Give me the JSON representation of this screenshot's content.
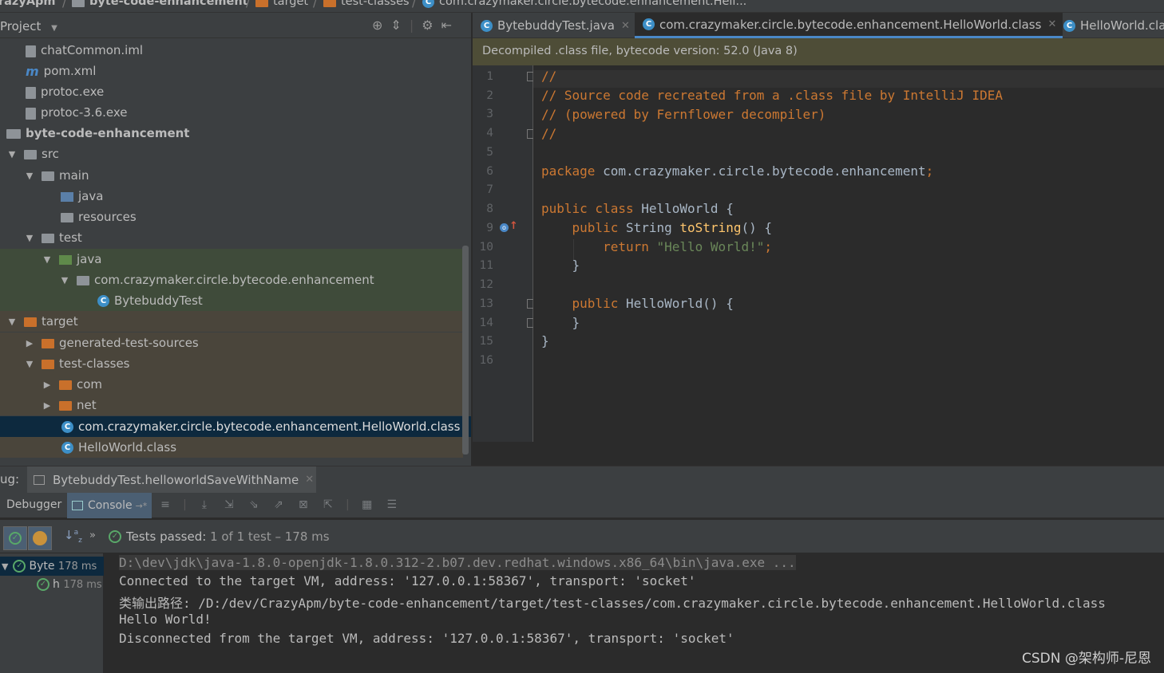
{
  "breadcrumb": {
    "items": [
      "razyApm",
      "byte-code-enhancement",
      "target",
      "test-classes",
      "com.crazymaker.circle.bytecode.enhancement.Hell..."
    ]
  },
  "project": {
    "title": "Project",
    "tree": [
      {
        "label": "chatCommon.iml",
        "icon": "iml-file-icon"
      },
      {
        "label": "pom.xml",
        "icon": "maven-icon"
      },
      {
        "label": "protoc.exe",
        "icon": "exe-file-icon"
      },
      {
        "label": "protoc-3.6.exe",
        "icon": "exe-file-icon"
      },
      {
        "label": "byte-code-enhancement",
        "icon": "module-icon"
      },
      {
        "label": "src",
        "icon": "folder-icon"
      },
      {
        "label": "main",
        "icon": "folder-icon"
      },
      {
        "label": "java",
        "icon": "source-folder-icon"
      },
      {
        "label": "resources",
        "icon": "resources-folder-icon"
      },
      {
        "label": "test",
        "icon": "folder-icon"
      },
      {
        "label": "java",
        "icon": "test-source-folder-icon"
      },
      {
        "label": "com.crazymaker.circle.bytecode.enhancement",
        "icon": "package-icon"
      },
      {
        "label": "BytebuddyTest",
        "icon": "class-icon"
      },
      {
        "label": "target",
        "icon": "excluded-folder-icon"
      },
      {
        "label": "generated-test-sources",
        "icon": "excluded-folder-icon"
      },
      {
        "label": "test-classes",
        "icon": "excluded-folder-icon"
      },
      {
        "label": "com",
        "icon": "excluded-folder-icon"
      },
      {
        "label": "net",
        "icon": "excluded-folder-icon"
      },
      {
        "label": "com.crazymaker.circle.bytecode.enhancement.HelloWorld.class",
        "icon": "class-file-icon"
      },
      {
        "label": "HelloWorld.class",
        "icon": "class-file-icon"
      }
    ]
  },
  "editor": {
    "tabs": [
      "BytebuddyTest.java",
      "com.crazymaker.circle.bytecode.enhancement.HelloWorld.class",
      "HelloWorld.cla"
    ],
    "banner": "Decompiled .class file, bytecode version: 52.0 (Java 8)",
    "line_numbers": [
      "1",
      "2",
      "3",
      "4",
      "5",
      "6",
      "7",
      "8",
      "9",
      "10",
      "11",
      "12",
      "13",
      "14",
      "15",
      "16"
    ],
    "code": {
      "l1": "//",
      "l2": "// Source code recreated from a .class file by IntelliJ IDEA",
      "l3": "// (powered by Fernflower decompiler)",
      "l4": "//",
      "l6_kw": "package",
      "l6_rest": " com.crazymaker.circle.bytecode.enhancement",
      "l6_semi": ";",
      "l8_kw": "public class",
      "l8_rest": " HelloWorld {",
      "l9_kw": "    public",
      "l9_type": " String ",
      "l9_fn": "toString",
      "l9_rest": "() {",
      "l10_kw": "        return",
      "l10_str": " \"Hello World!\"",
      "l10_semi": ";",
      "l11": "    }",
      "l13_kw": "    public",
      "l13_rest": " HelloWorld() {",
      "l14": "    }",
      "l15": "}"
    }
  },
  "debug": {
    "prefix": "ug:",
    "run_config": "BytebuddyTest.helloworldSaveWithName",
    "tab_debugger": "Debugger",
    "tab_console": "Console",
    "tests_passed_label": "Tests passed:",
    "tests_passed_value": "1 of 1 test – 178 ms",
    "tree": [
      {
        "label": "Byte",
        "time": "178 ms"
      },
      {
        "label": "h",
        "time": "178 ms"
      }
    ],
    "console": [
      "D:\\dev\\jdk\\java-1.8.0-openjdk-1.8.0.312-2.b07.dev.redhat.windows.x86_64\\bin\\java.exe ...",
      "Connected to the target VM, address: '127.0.0.1:58367', transport: 'socket'",
      "类输出路径: /D:/dev/CrazyApm/byte-code-enhancement/target/test-classes/com.crazymaker.circle.bytecode.enhancement.HelloWorld.class",
      "Hello World!",
      "Disconnected from the target VM, address: '127.0.0.1:58367', transport: 'socket'"
    ]
  },
  "watermark": "CSDN @架构师-尼恩",
  "colors": {
    "keyword": "#cc7832",
    "string": "#6a8759",
    "method": "#ffc66d",
    "selection": "#0d293e",
    "pass_green": "#59a869"
  }
}
